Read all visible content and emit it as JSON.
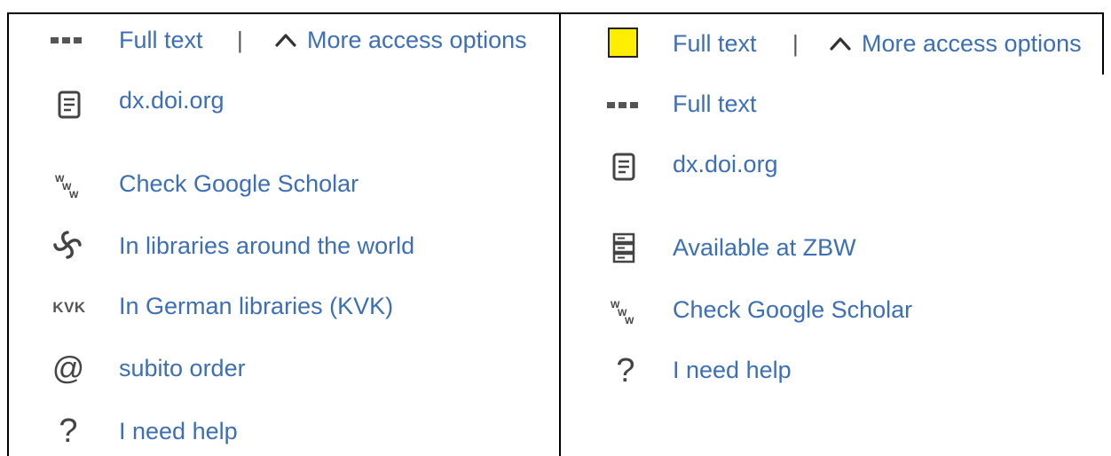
{
  "left_panel": {
    "header": {
      "full_text_label": "Full text",
      "separator": "|",
      "more_options_label": "More access options"
    },
    "items": [
      {
        "icon": "document-icon",
        "label": "dx.doi.org"
      },
      {
        "icon": "www-icon",
        "label": "Check Google Scholar"
      },
      {
        "icon": "worldcat-swirl-icon",
        "label": "In libraries around the world"
      },
      {
        "icon": "kvk-icon",
        "icon_text": "KVK",
        "label": "In German libraries (KVK)"
      },
      {
        "icon": "at-icon",
        "icon_text": "@",
        "label": "subito order"
      },
      {
        "icon": "question-icon",
        "icon_text": "?",
        "label": "I need help"
      }
    ]
  },
  "right_panel": {
    "header": {
      "full_text_label": "Full text",
      "separator": "|",
      "more_options_label": "More access options",
      "highlight_color": "#ffee00"
    },
    "items": [
      {
        "icon": "dots-icon",
        "label": "Full text"
      },
      {
        "icon": "document-icon",
        "label": "dx.doi.org"
      },
      {
        "icon": "server-icon",
        "label": "Available at ZBW"
      },
      {
        "icon": "www-icon",
        "label": "Check Google Scholar"
      },
      {
        "icon": "question-icon",
        "icon_text": "?",
        "label": "I need help"
      }
    ]
  },
  "colors": {
    "link": "#3c6fb4",
    "icon": "#555555"
  }
}
